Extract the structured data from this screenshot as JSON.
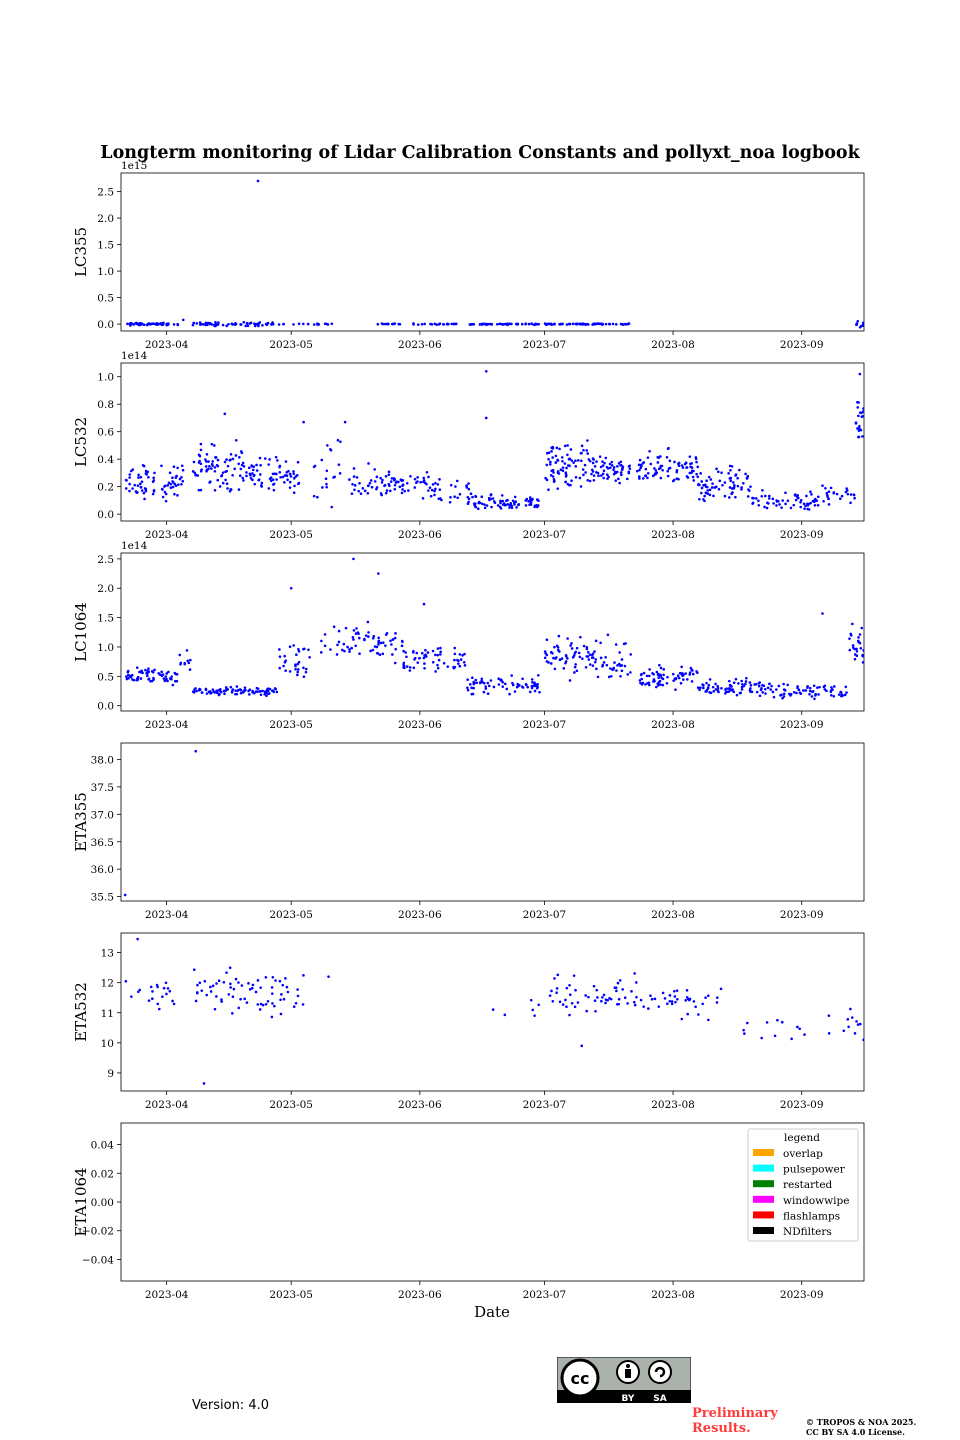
{
  "title": "Longterm monitoring of Lidar Calibration Constants and pollyxt_noa logbook",
  "xlabel": "Date",
  "version": "Version: 4.0",
  "preliminary": [
    "Preliminary",
    "Results."
  ],
  "copyright": [
    "© TROPOS & NOA 2025.",
    "CC BY SA 4.0 License."
  ],
  "license_badge": {
    "text_left": "BY",
    "text_right": "SA"
  },
  "colors": {
    "series": "#0000ff",
    "axes": "#000000"
  },
  "chart_data": [
    {
      "type": "scatter",
      "ylabel": "LC355",
      "offset_text": "1e15",
      "xlim": [
        "2023-03-21",
        "2023-09-16"
      ],
      "ylim": [
        -0.13,
        2.85
      ],
      "yticks": [
        "0.0",
        "0.5",
        "1.0",
        "1.5",
        "2.0",
        "2.5"
      ],
      "ytick_values": [
        0,
        0.5,
        1.0,
        1.5,
        2.0,
        2.5
      ],
      "xticks": [
        "2023-04",
        "2023-05",
        "2023-06",
        "2023-07",
        "2023-08",
        "2023-09"
      ],
      "segments": [
        [
          "2023-03-22",
          "2023-04-04",
          0.0,
          0.02,
          55
        ],
        [
          "2023-04-07",
          "2023-04-27",
          0.0,
          0.03,
          60
        ],
        [
          "2023-04-28",
          "2023-05-14",
          0.0,
          0.01,
          16
        ],
        [
          "2023-05-20",
          "2023-06-10",
          0.0,
          0.01,
          35
        ],
        [
          "2023-06-13",
          "2023-06-30",
          0.0,
          0.01,
          50
        ],
        [
          "2023-07-01",
          "2023-07-22",
          0.0,
          0.01,
          65
        ],
        [
          "2023-09-14",
          "2023-09-16",
          0.0,
          0.04,
          10
        ]
      ],
      "points": [
        [
          "2023-04-05",
          0.08
        ],
        [
          "2023-04-23",
          2.7
        ]
      ]
    },
    {
      "type": "scatter",
      "ylabel": "LC532",
      "offset_text": "1e14",
      "xlim": [
        "2023-03-21",
        "2023-09-16"
      ],
      "ylim": [
        -0.05,
        1.1
      ],
      "yticks": [
        "0.0",
        "0.2",
        "0.4",
        "0.6",
        "0.8",
        "1.0"
      ],
      "ytick_values": [
        0,
        0.2,
        0.4,
        0.6,
        0.8,
        1.0
      ],
      "xticks": [
        "2023-04",
        "2023-05",
        "2023-06",
        "2023-07",
        "2023-08",
        "2023-09"
      ],
      "segments": [
        [
          "2023-03-22",
          "2023-03-28",
          0.25,
          0.1,
          35
        ],
        [
          "2023-03-28",
          "2023-04-05",
          0.22,
          0.12,
          40
        ],
        [
          "2023-04-07",
          "2023-04-20",
          0.35,
          0.14,
          80
        ],
        [
          "2023-04-20",
          "2023-05-03",
          0.28,
          0.1,
          70
        ],
        [
          "2023-05-06",
          "2023-05-15",
          0.3,
          0.2,
          20
        ],
        [
          "2023-05-15",
          "2023-05-25",
          0.22,
          0.1,
          40
        ],
        [
          "2023-05-25",
          "2023-06-05",
          0.2,
          0.08,
          45
        ],
        [
          "2023-06-05",
          "2023-06-14",
          0.15,
          0.08,
          25
        ],
        [
          "2023-06-14",
          "2023-06-30",
          0.08,
          0.05,
          75
        ],
        [
          "2023-07-01",
          "2023-07-12",
          0.35,
          0.16,
          80
        ],
        [
          "2023-07-12",
          "2023-07-22",
          0.32,
          0.08,
          60
        ],
        [
          "2023-07-23",
          "2023-08-07",
          0.33,
          0.1,
          80
        ],
        [
          "2023-08-07",
          "2023-08-20",
          0.22,
          0.1,
          70
        ],
        [
          "2023-08-20",
          "2023-09-05",
          0.1,
          0.06,
          60
        ],
        [
          "2023-09-06",
          "2023-09-14",
          0.15,
          0.08,
          25
        ],
        [
          "2023-09-14",
          "2023-09-16",
          0.7,
          0.15,
          20
        ]
      ],
      "points": [
        [
          "2023-04-15",
          0.73
        ],
        [
          "2023-06-17",
          1.04
        ],
        [
          "2023-06-17",
          0.7
        ],
        [
          "2023-05-04",
          0.67
        ],
        [
          "2023-05-14",
          0.67
        ],
        [
          "2023-09-15",
          1.02
        ]
      ]
    },
    {
      "type": "scatter",
      "ylabel": "LC1064",
      "offset_text": "1e14",
      "xlim": [
        "2023-03-21",
        "2023-09-16"
      ],
      "ylim": [
        -0.09,
        2.6
      ],
      "yticks": [
        "0.0",
        "0.5",
        "1.0",
        "1.5",
        "2.0",
        "2.5"
      ],
      "ytick_values": [
        0,
        0.5,
        1.0,
        1.5,
        2.0,
        2.5
      ],
      "xticks": [
        "2023-04",
        "2023-05",
        "2023-06",
        "2023-07",
        "2023-08",
        "2023-09"
      ],
      "segments": [
        [
          "2023-03-22",
          "2023-04-04",
          0.5,
          0.12,
          60
        ],
        [
          "2023-04-04",
          "2023-04-07",
          0.75,
          0.2,
          10
        ],
        [
          "2023-04-07",
          "2023-04-28",
          0.25,
          0.06,
          90
        ],
        [
          "2023-04-28",
          "2023-05-06",
          0.75,
          0.3,
          30
        ],
        [
          "2023-05-08",
          "2023-05-15",
          1.0,
          0.25,
          15
        ],
        [
          "2023-05-15",
          "2023-05-28",
          1.1,
          0.25,
          50
        ],
        [
          "2023-05-28",
          "2023-06-12",
          0.8,
          0.2,
          60
        ],
        [
          "2023-06-12",
          "2023-06-30",
          0.35,
          0.12,
          70
        ],
        [
          "2023-07-01",
          "2023-07-22",
          0.8,
          0.3,
          100
        ],
        [
          "2023-07-24",
          "2023-08-07",
          0.5,
          0.15,
          70
        ],
        [
          "2023-08-07",
          "2023-08-25",
          0.32,
          0.12,
          80
        ],
        [
          "2023-08-25",
          "2023-09-12",
          0.25,
          0.1,
          60
        ],
        [
          "2023-09-12",
          "2023-09-16",
          1.0,
          0.35,
          25
        ]
      ],
      "points": [
        [
          "2023-05-01",
          2.0
        ],
        [
          "2023-05-16",
          2.5
        ],
        [
          "2023-05-22",
          2.25
        ],
        [
          "2023-06-02",
          1.73
        ],
        [
          "2023-09-06",
          1.57
        ]
      ]
    },
    {
      "type": "scatter",
      "ylabel": "ETA355",
      "offset_text": "",
      "xlim": [
        "2023-03-21",
        "2023-09-16"
      ],
      "ylim": [
        35.42,
        38.3
      ],
      "yticks": [
        "35.5",
        "36.0",
        "36.5",
        "37.0",
        "37.5",
        "38.0"
      ],
      "ytick_values": [
        35.5,
        36.0,
        36.5,
        37.0,
        37.5,
        38.0
      ],
      "xticks": [
        "2023-04",
        "2023-05",
        "2023-06",
        "2023-07",
        "2023-08",
        "2023-09"
      ],
      "segments": [],
      "points": [
        [
          "2023-03-22",
          35.53
        ],
        [
          "2023-04-08",
          38.15
        ]
      ]
    },
    {
      "type": "scatter",
      "ylabel": "ETA532",
      "offset_text": "",
      "xlim": [
        "2023-03-21",
        "2023-09-16"
      ],
      "ylim": [
        8.4,
        13.65
      ],
      "yticks": [
        "9",
        "10",
        "11",
        "12",
        "13"
      ],
      "ytick_values": [
        9,
        10,
        11,
        12,
        13
      ],
      "xticks": [
        "2023-04",
        "2023-05",
        "2023-06",
        "2023-07",
        "2023-08",
        "2023-09"
      ],
      "segments": [
        [
          "2023-03-22",
          "2023-04-06",
          11.6,
          0.6,
          20
        ],
        [
          "2023-04-07",
          "2023-05-04",
          11.6,
          0.6,
          70
        ],
        [
          "2023-06-14",
          "2023-06-30",
          10.9,
          0.5,
          6
        ],
        [
          "2023-07-02",
          "2023-07-25",
          11.6,
          0.5,
          55
        ],
        [
          "2023-07-26",
          "2023-08-14",
          11.3,
          0.5,
          35
        ],
        [
          "2023-08-16",
          "2023-09-02",
          10.5,
          0.5,
          12
        ],
        [
          "2023-09-07",
          "2023-09-16",
          10.6,
          0.6,
          12
        ]
      ],
      "points": [
        [
          "2023-03-25",
          13.45
        ],
        [
          "2023-04-10",
          8.65
        ],
        [
          "2023-05-10",
          12.2
        ],
        [
          "2023-07-10",
          9.9
        ]
      ]
    },
    {
      "type": "scatter",
      "ylabel": "ETA1064",
      "offset_text": "",
      "xlim": [
        "2023-03-21",
        "2023-09-16"
      ],
      "ylim": [
        -0.055,
        0.055
      ],
      "yticks": [
        "−0.04",
        "−0.02",
        "0.00",
        "0.02",
        "0.04"
      ],
      "ytick_values": [
        -0.04,
        -0.02,
        0.0,
        0.02,
        0.04
      ],
      "xticks": [
        "2023-04",
        "2023-05",
        "2023-06",
        "2023-07",
        "2023-08",
        "2023-09"
      ],
      "segments": [],
      "points": [],
      "legend": {
        "title": "legend",
        "placement": "top-right",
        "entries": [
          {
            "label": "overlap",
            "color": "#ffa500"
          },
          {
            "label": "pulsepower",
            "color": "#00ffff"
          },
          {
            "label": "restarted",
            "color": "#008000"
          },
          {
            "label": "windowwipe",
            "color": "#ff00ff"
          },
          {
            "label": "flashlamps",
            "color": "#ff0000"
          },
          {
            "label": "NDfilters",
            "color": "#000000"
          }
        ]
      }
    }
  ]
}
